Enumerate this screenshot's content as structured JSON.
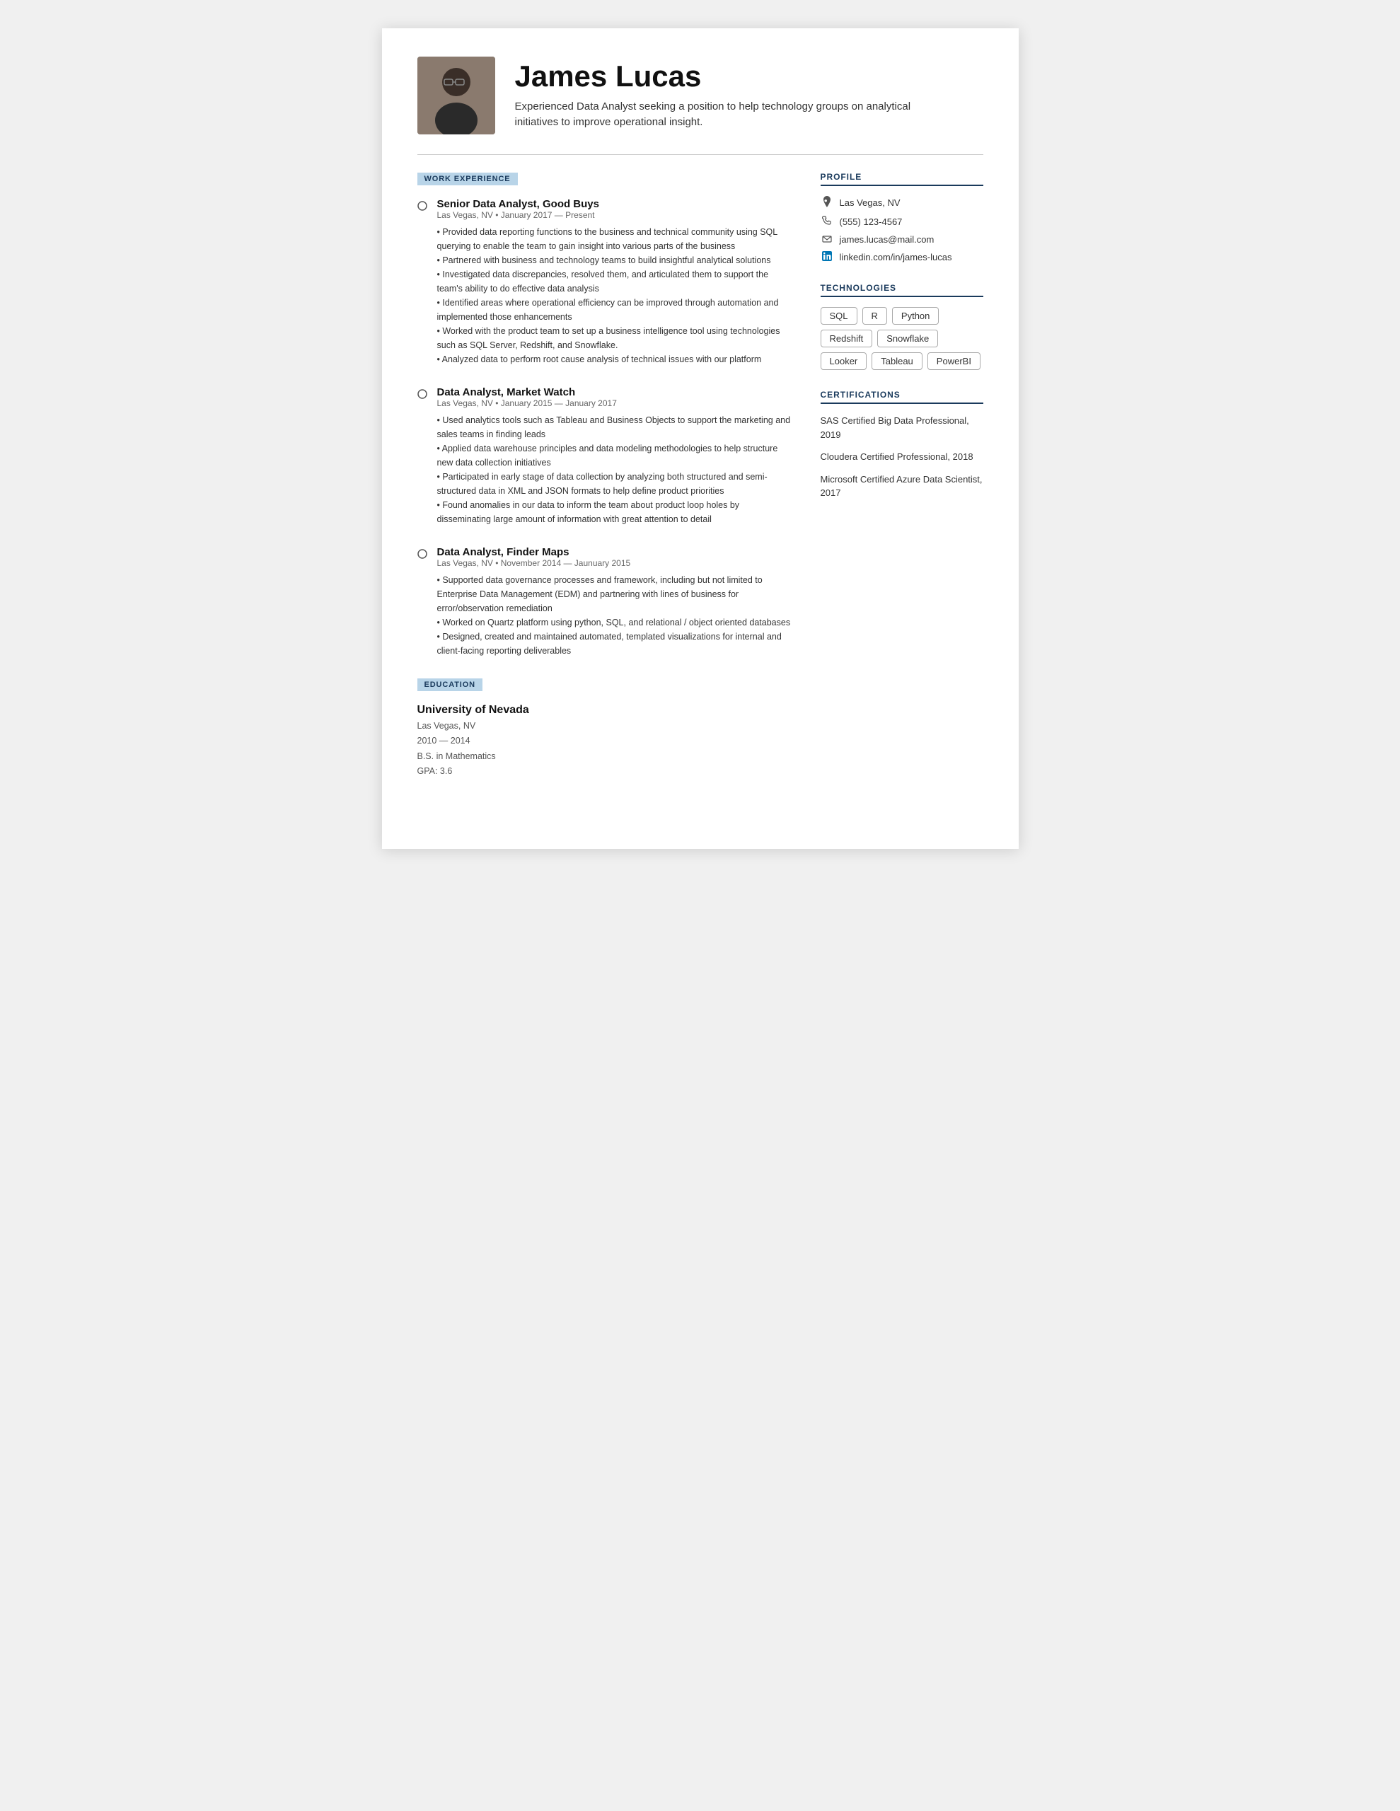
{
  "header": {
    "name": "James Lucas",
    "tagline": "Experienced Data Analyst seeking a position to help technology groups on analytical initiatives to improve operational insight.",
    "avatar_label": "Profile Photo"
  },
  "sections": {
    "work_experience_label": "WORK EXPERIENCE",
    "education_label": "EDUCATION"
  },
  "jobs": [
    {
      "title": "Senior Data Analyst, Good Buys",
      "meta": "Las Vegas, NV • January 2017 — Present",
      "description": "• Provided data reporting functions to the business and technical community using SQL querying to enable the team to gain insight into various parts of the business\n• Partnered with business and technology teams to build insightful analytical solutions\n• Investigated data discrepancies, resolved them, and articulated them to support the team's ability to do effective data analysis\n• Identified areas where operational efficiency can be improved through automation and implemented those enhancements\n• Worked with the product team to set up a business intelligence tool using technologies such as SQL Server, Redshift, and Snowflake.\n• Analyzed data to perform root cause analysis of technical issues with our platform"
    },
    {
      "title": "Data Analyst, Market Watch",
      "meta": "Las Vegas, NV • January 2015 — January 2017",
      "description": "• Used analytics tools such as Tableau and Business Objects to support the marketing and sales teams in finding leads\n• Applied data warehouse principles and data modeling methodologies to help structure new data collection initiatives\n• Participated in early stage of data collection by analyzing both structured and semi-structured data in XML and JSON formats to help define product priorities\n• Found anomalies in our data to inform the team about product loop holes by disseminating large amount of information with great attention to detail"
    },
    {
      "title": "Data Analyst, Finder Maps",
      "meta": "Las Vegas, NV • November 2014 — Jaunuary 2015",
      "description": "• Supported data governance processes and framework, including but not limited to Enterprise Data Management (EDM) and partnering with lines of business for error/observation remediation\n• Worked on Quartz platform using python, SQL, and relational / object oriented databases\n• Designed, created and maintained automated, templated visualizations for internal and client-facing reporting deliverables"
    }
  ],
  "education": {
    "school": "University of Nevada",
    "location": "Las Vegas, NV",
    "years": "2010 — 2014",
    "degree": "B.S. in Mathematics",
    "gpa": "GPA: 3.6"
  },
  "profile": {
    "label": "PROFILE",
    "location": "Las Vegas, NV",
    "phone": "(555) 123-4567",
    "email": "james.lucas@mail.com",
    "linkedin": "linkedin.com/in/james-lucas"
  },
  "technologies": {
    "label": "TECHNOLOGIES",
    "items": [
      "SQL",
      "R",
      "Python",
      "Redshift",
      "Snowflake",
      "Looker",
      "Tableau",
      "PowerBI"
    ]
  },
  "certifications": {
    "label": "CERTIFICATIONS",
    "items": [
      "SAS Certified Big Data Professional, 2019",
      "Cloudera Certified Professional, 2018",
      "Microsoft Certified Azure Data Scientist, 2017"
    ]
  }
}
